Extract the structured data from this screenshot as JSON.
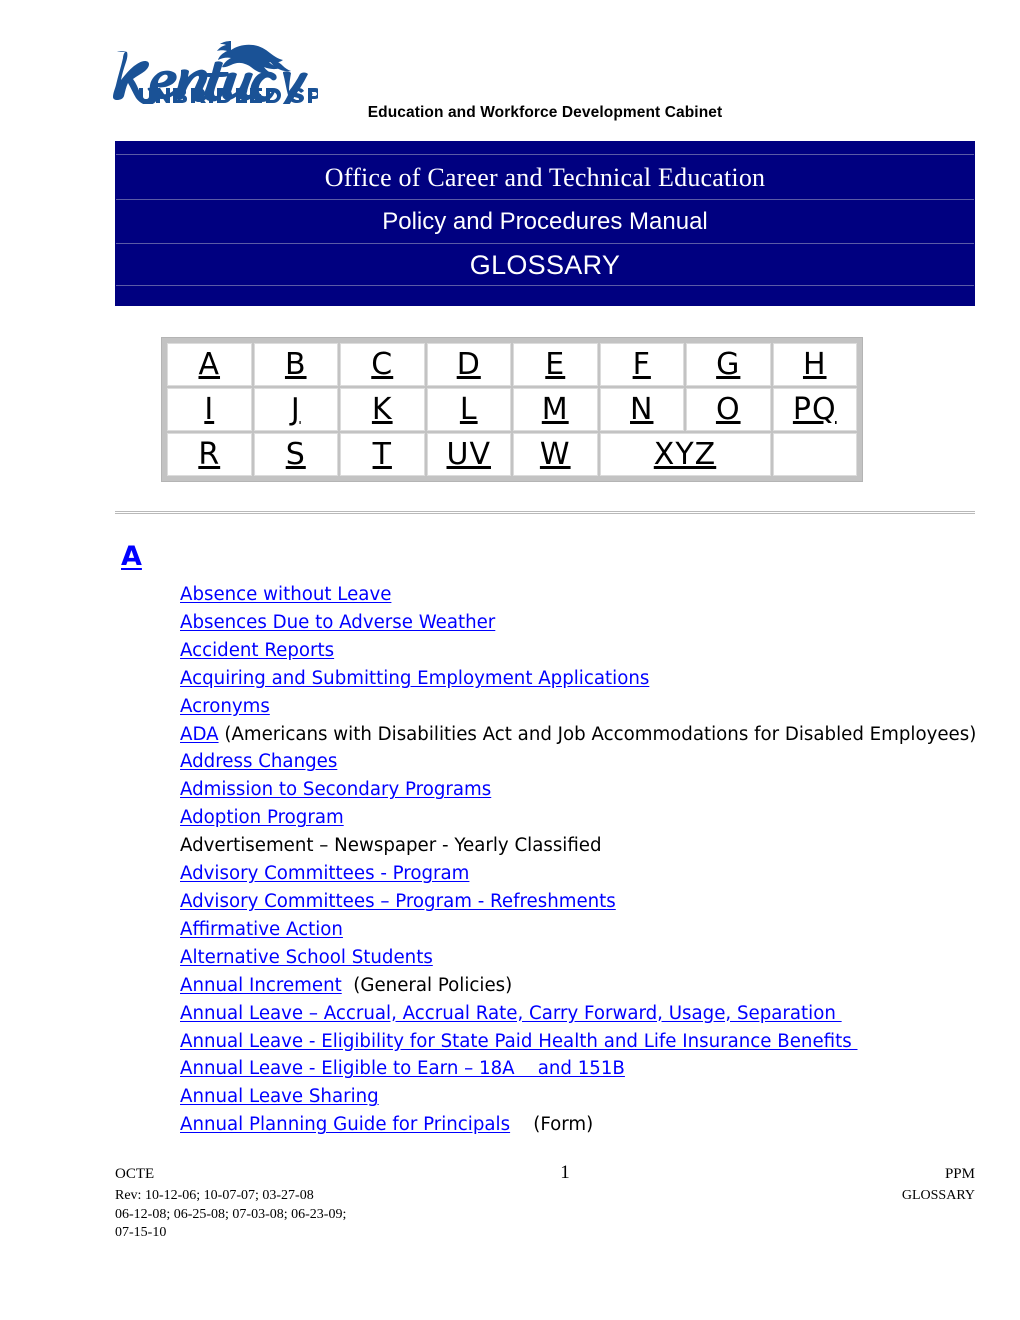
{
  "logo": {
    "wordmark": "Kentucky",
    "tagline": "UNBRIDLED SPIRIT",
    "trademark": "™",
    "color": "#1a5296"
  },
  "header": {
    "cabinet": "Education and Workforce Development Cabinet"
  },
  "banner": {
    "background_color": "#000080",
    "divider_color": "#5b5ba5",
    "text_color": "#ffffff",
    "office": "Office of Career and Technical Education",
    "manual": "Policy and Procedures Manual",
    "section": "GLOSSARY"
  },
  "alphabet_nav": {
    "rows": [
      [
        {
          "label": "A",
          "colspan": 1
        },
        {
          "label": "B",
          "colspan": 1
        },
        {
          "label": "C",
          "colspan": 1
        },
        {
          "label": "D",
          "colspan": 1
        },
        {
          "label": "E",
          "colspan": 1
        },
        {
          "label": "F",
          "colspan": 1
        },
        {
          "label": "G",
          "colspan": 1
        },
        {
          "label": "H",
          "colspan": 1
        }
      ],
      [
        {
          "label": "I",
          "colspan": 1
        },
        {
          "label": "J",
          "colspan": 1
        },
        {
          "label": "K",
          "colspan": 1
        },
        {
          "label": "L",
          "colspan": 1
        },
        {
          "label": "M",
          "colspan": 1
        },
        {
          "label": "N",
          "colspan": 1
        },
        {
          "label": "O",
          "colspan": 1
        },
        {
          "label": "PQ",
          "colspan": 1
        }
      ],
      [
        {
          "label": "R",
          "colspan": 1
        },
        {
          "label": "S",
          "colspan": 1
        },
        {
          "label": "T",
          "colspan": 1
        },
        {
          "label": "UV",
          "colspan": 1
        },
        {
          "label": "W",
          "colspan": 1
        },
        {
          "label": "XYZ",
          "colspan": 2
        },
        {
          "label": "",
          "colspan": 1
        }
      ]
    ]
  },
  "section": {
    "heading": "A",
    "heading_color": "#0000ff",
    "link_color": "#0000ff",
    "entries": [
      {
        "parts": [
          {
            "text": "Absence without Leave",
            "link": true
          }
        ]
      },
      {
        "parts": [
          {
            "text": "Absences Due to Adverse Weather",
            "link": true
          }
        ]
      },
      {
        "parts": [
          {
            "text": "Accident Reports",
            "link": true
          }
        ]
      },
      {
        "parts": [
          {
            "text": "Acquiring and Submitting Employment Applications",
            "link": true
          }
        ]
      },
      {
        "parts": [
          {
            "text": "Acronyms",
            "link": true
          }
        ]
      },
      {
        "parts": [
          {
            "text": "ADA",
            "link": true
          },
          {
            "text": " (Americans with Disabilities Act and Job Accommodations for Disabled Employees)",
            "link": false
          }
        ]
      },
      {
        "parts": [
          {
            "text": "Address Changes",
            "link": true
          }
        ]
      },
      {
        "parts": [
          {
            "text": "Admission to Secondary Programs",
            "link": true
          }
        ]
      },
      {
        "parts": [
          {
            "text": "Adoption Program",
            "link": true
          }
        ]
      },
      {
        "parts": [
          {
            "text": "Advertisement – Newspaper - Yearly Classified",
            "link": false
          }
        ]
      },
      {
        "parts": [
          {
            "text": "Advisory Committees - Program",
            "link": true
          }
        ]
      },
      {
        "parts": [
          {
            "text": "Advisory Committees – Program - Refreshments",
            "link": true
          }
        ]
      },
      {
        "parts": [
          {
            "text": "Affirmative Action",
            "link": true
          }
        ]
      },
      {
        "parts": [
          {
            "text": "Alternative School Students",
            "link": true
          }
        ]
      },
      {
        "parts": [
          {
            "text": "Annual Increment",
            "link": true
          },
          {
            "text": "  (General Policies)",
            "link": false
          }
        ]
      },
      {
        "parts": [
          {
            "text": "Annual Leave – Accrual, Accrual Rate, Carry Forward, Usage, Separation ",
            "link": true
          }
        ]
      },
      {
        "parts": [
          {
            "text": "Annual Leave - Eligibility for State Paid Health and Life Insurance Benefits ",
            "link": true
          }
        ]
      },
      {
        "parts": [
          {
            "text": "Annual Leave - Eligible to Earn – 18A    and 151B",
            "link": true
          }
        ]
      },
      {
        "parts": [
          {
            "text": "Annual Leave Sharing",
            "link": true
          }
        ]
      },
      {
        "parts": [
          {
            "text": "Annual Planning Guide for Principals",
            "link": true
          },
          {
            "text": "    (Form)",
            "link": false
          }
        ]
      }
    ]
  },
  "footer": {
    "left_main": "OCTE",
    "page_number": "1",
    "right_main": "PPM",
    "rev_line_1": "Rev:  10-12-06; 10-07-07; 03-27-08",
    "right_sub": "GLOSSARY",
    "rev_line_2": "06-12-08; 06-25-08; 07-03-08; 06-23-09;",
    "rev_line_3": "07-15-10"
  }
}
